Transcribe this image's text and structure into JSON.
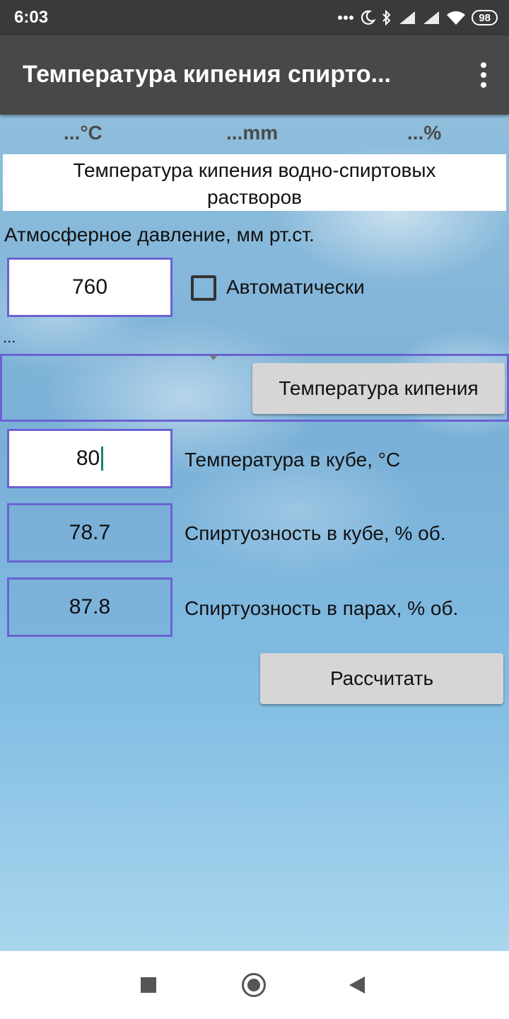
{
  "status_bar": {
    "time": "6:03",
    "battery": "98",
    "icons": [
      "more-dots-icon",
      "moon-icon",
      "bluetooth-icon",
      "signal-icon",
      "signal-icon",
      "wifi-icon",
      "battery-icon"
    ]
  },
  "app_bar": {
    "title": "Температура кипения спирто...",
    "menu_icon": "overflow-menu-icon"
  },
  "indicators": {
    "temp": "...°C",
    "pressure": "...mm",
    "percent": "...%"
  },
  "header": {
    "title_line1": "Температура кипения водно-спиртовых",
    "title_line2": "растворов"
  },
  "pressure": {
    "label": "Атмосферное давление, мм рт.ст.",
    "value": "760",
    "auto_label": "Автоматически",
    "auto_checked": false,
    "status_text": "..."
  },
  "boiling_button": {
    "label": "Температура кипения"
  },
  "rows": {
    "cube_temp": {
      "value": "80",
      "label": "Температура в кубе, °C"
    },
    "cube_strength": {
      "value": "78.7",
      "label": "Спиртуозность в кубе, % об."
    },
    "vapor_strength": {
      "value": "87.8",
      "label": "Спиртуозность в парах, % об."
    }
  },
  "calculate_button": {
    "label": "Рассчитать"
  },
  "nav_bar": {
    "icons": [
      "recents-square-icon",
      "home-circle-icon",
      "back-triangle-icon"
    ]
  }
}
